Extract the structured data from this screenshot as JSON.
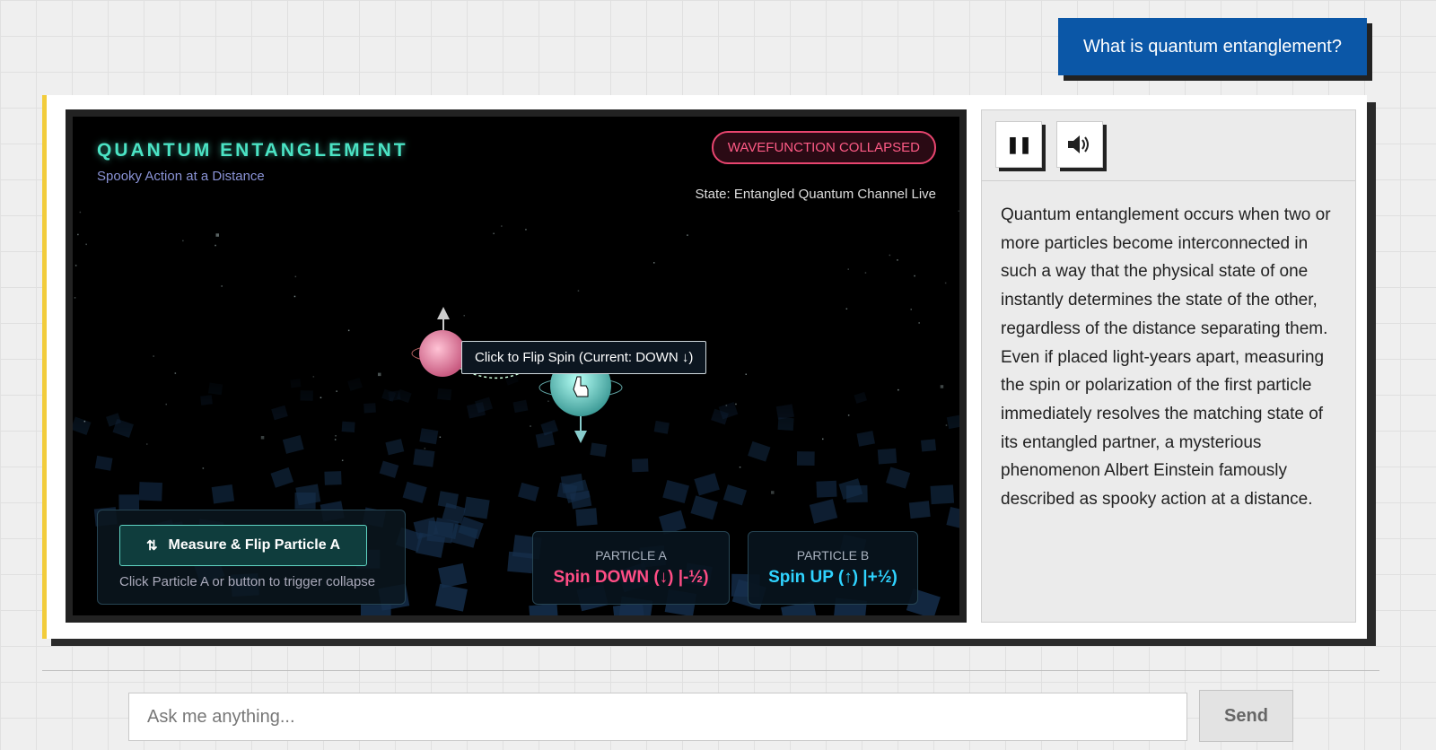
{
  "user_message": "What is quantum entanglement?",
  "simulation": {
    "title": "QUANTUM ENTANGLEMENT",
    "subtitle": "Spooky Action at a Distance",
    "status_badge": "WAVEFUNCTION COLLAPSED",
    "state_text": "State: Entangled Quantum Channel Live",
    "tooltip": "Click to Flip Spin (Current: DOWN ↓)",
    "measure_button": {
      "icon": "swap-vertical-icon",
      "label": "Measure & Flip Particle A"
    },
    "control_hint": "Click Particle A or button to trigger collapse",
    "particle_a": {
      "label": "PARTICLE A",
      "value": "Spin DOWN (↓) |-½)",
      "color": "#ff4d85"
    },
    "particle_b": {
      "label": "PARTICLE B",
      "value": "Spin UP (↑) |+½)",
      "color": "#2fd3ff"
    }
  },
  "side_panel": {
    "pause_icon": "pause-icon",
    "speaker_icon": "speaker-icon",
    "explanation": "Quantum entanglement occurs when two or more particles become interconnected in such a way that the physical state of one instantly determines the state of the other, regardless of the distance separating them. Even if placed light-years apart, measuring the spin or polarization of the first particle immediately resolves the matching state of its entangled partner, a mysterious phenomenon Albert Einstein famously described as spooky action at a distance."
  },
  "chat": {
    "placeholder": "Ask me anything...",
    "send_label": "Send"
  },
  "colors": {
    "user_bubble": "#0b57a7",
    "accent_teal": "#4be3c4",
    "card_accent": "#f2cc3b",
    "collapsed_pink": "#ff5b86"
  }
}
